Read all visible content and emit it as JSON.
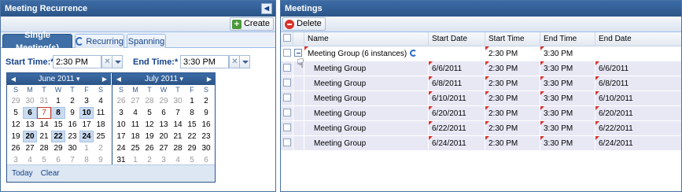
{
  "left_panel": {
    "title": "Meeting Recurrence",
    "create_label": "Create",
    "tabs": [
      {
        "label": "Single Meeting(s)",
        "active": true
      },
      {
        "label": "Recurring",
        "active": false
      },
      {
        "label": "Spanning",
        "active": false
      }
    ],
    "start_label": "Start Time:*",
    "start_value": "2:30 PM",
    "end_label": "End Time:*",
    "end_value": "3:30 PM",
    "calendars": [
      {
        "title": "June 2011",
        "days": [
          {
            "d": "29",
            "s": "other"
          },
          {
            "d": "30",
            "s": "other"
          },
          {
            "d": "31",
            "s": "other"
          },
          {
            "d": "1",
            "s": ""
          },
          {
            "d": "2",
            "s": ""
          },
          {
            "d": "3",
            "s": ""
          },
          {
            "d": "4",
            "s": ""
          },
          {
            "d": "5",
            "s": ""
          },
          {
            "d": "6",
            "s": "sel"
          },
          {
            "d": "7",
            "s": "today"
          },
          {
            "d": "8",
            "s": "sel"
          },
          {
            "d": "9",
            "s": ""
          },
          {
            "d": "10",
            "s": "sel"
          },
          {
            "d": "11",
            "s": ""
          },
          {
            "d": "12",
            "s": ""
          },
          {
            "d": "13",
            "s": ""
          },
          {
            "d": "14",
            "s": ""
          },
          {
            "d": "15",
            "s": ""
          },
          {
            "d": "16",
            "s": ""
          },
          {
            "d": "17",
            "s": ""
          },
          {
            "d": "18",
            "s": ""
          },
          {
            "d": "19",
            "s": ""
          },
          {
            "d": "20",
            "s": "sel"
          },
          {
            "d": "21",
            "s": ""
          },
          {
            "d": "22",
            "s": "sel"
          },
          {
            "d": "23",
            "s": ""
          },
          {
            "d": "24",
            "s": "sel"
          },
          {
            "d": "25",
            "s": ""
          },
          {
            "d": "26",
            "s": ""
          },
          {
            "d": "27",
            "s": ""
          },
          {
            "d": "28",
            "s": ""
          },
          {
            "d": "29",
            "s": ""
          },
          {
            "d": "30",
            "s": ""
          },
          {
            "d": "1",
            "s": "other"
          },
          {
            "d": "2",
            "s": "other"
          },
          {
            "d": "3",
            "s": "other"
          },
          {
            "d": "4",
            "s": "other"
          },
          {
            "d": "5",
            "s": "other"
          },
          {
            "d": "6",
            "s": "other"
          },
          {
            "d": "7",
            "s": "other"
          },
          {
            "d": "8",
            "s": "other"
          },
          {
            "d": "9",
            "s": "other"
          }
        ]
      },
      {
        "title": "July 2011",
        "days": [
          {
            "d": "26",
            "s": "other"
          },
          {
            "d": "27",
            "s": "other"
          },
          {
            "d": "28",
            "s": "other"
          },
          {
            "d": "29",
            "s": "other"
          },
          {
            "d": "30",
            "s": "other"
          },
          {
            "d": "1",
            "s": ""
          },
          {
            "d": "2",
            "s": ""
          },
          {
            "d": "3",
            "s": ""
          },
          {
            "d": "4",
            "s": ""
          },
          {
            "d": "5",
            "s": ""
          },
          {
            "d": "6",
            "s": ""
          },
          {
            "d": "7",
            "s": ""
          },
          {
            "d": "8",
            "s": ""
          },
          {
            "d": "9",
            "s": ""
          },
          {
            "d": "10",
            "s": ""
          },
          {
            "d": "11",
            "s": ""
          },
          {
            "d": "12",
            "s": ""
          },
          {
            "d": "13",
            "s": ""
          },
          {
            "d": "14",
            "s": ""
          },
          {
            "d": "15",
            "s": ""
          },
          {
            "d": "16",
            "s": ""
          },
          {
            "d": "17",
            "s": ""
          },
          {
            "d": "18",
            "s": ""
          },
          {
            "d": "19",
            "s": ""
          },
          {
            "d": "20",
            "s": ""
          },
          {
            "d": "21",
            "s": ""
          },
          {
            "d": "22",
            "s": ""
          },
          {
            "d": "23",
            "s": ""
          },
          {
            "d": "24",
            "s": ""
          },
          {
            "d": "25",
            "s": ""
          },
          {
            "d": "26",
            "s": ""
          },
          {
            "d": "27",
            "s": ""
          },
          {
            "d": "28",
            "s": ""
          },
          {
            "d": "29",
            "s": ""
          },
          {
            "d": "30",
            "s": ""
          },
          {
            "d": "31",
            "s": ""
          },
          {
            "d": "1",
            "s": "other"
          },
          {
            "d": "2",
            "s": "other"
          },
          {
            "d": "3",
            "s": "other"
          },
          {
            "d": "4",
            "s": "other"
          },
          {
            "d": "5",
            "s": "other"
          },
          {
            "d": "6",
            "s": "other"
          }
        ]
      }
    ],
    "weekdays": [
      "S",
      "M",
      "T",
      "W",
      "T",
      "F",
      "S"
    ],
    "today_label": "Today",
    "clear_label": "Clear"
  },
  "right_panel": {
    "title": "Meetings",
    "delete_label": "Delete",
    "columns": [
      "Name",
      "Start Date",
      "Start Time",
      "End Time",
      "End Date"
    ],
    "group": {
      "name": "Meeting Group (6 instances)",
      "start_date": "",
      "start_time": "2:30 PM",
      "end_time": "3:30 PM",
      "end_date": ""
    },
    "rows": [
      {
        "name": "Meeting Group",
        "start_date": "6/6/2011",
        "start_time": "2:30 PM",
        "end_time": "3:30 PM",
        "end_date": "6/6/2011"
      },
      {
        "name": "Meeting Group",
        "start_date": "6/8/2011",
        "start_time": "2:30 PM",
        "end_time": "3:30 PM",
        "end_date": "6/8/2011"
      },
      {
        "name": "Meeting Group",
        "start_date": "6/10/2011",
        "start_time": "2:30 PM",
        "end_time": "3:30 PM",
        "end_date": "6/10/2011"
      },
      {
        "name": "Meeting Group",
        "start_date": "6/20/2011",
        "start_time": "2:30 PM",
        "end_time": "3:30 PM",
        "end_date": "6/20/2011"
      },
      {
        "name": "Meeting Group",
        "start_date": "6/22/2011",
        "start_time": "2:30 PM",
        "end_time": "3:30 PM",
        "end_date": "6/22/2011"
      },
      {
        "name": "Meeting Group",
        "start_date": "6/24/2011",
        "start_time": "2:30 PM",
        "end_time": "3:30 PM",
        "end_date": "6/24/2011"
      }
    ]
  }
}
